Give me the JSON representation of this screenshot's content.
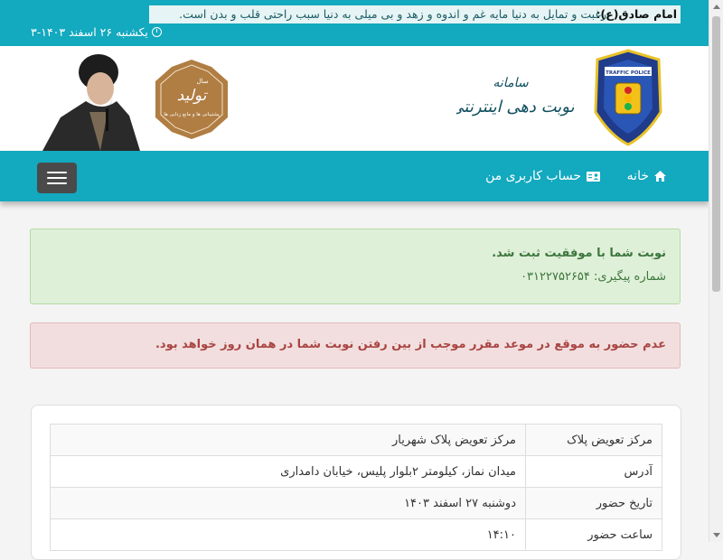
{
  "topbar": {
    "quote_label": "امام صادق(ع):",
    "quote_text": "رغبت و تمایل به دنیا مایه غم و اندوه و زهد و بی میلی به دنیا سبب راحتی قلب و بدن است.",
    "date": "یکشنبه ۲۶ اسفند ۱۴۰۳-۳",
    "clock_icon": "clock-icon"
  },
  "header": {
    "system_title_line1": "سامانه",
    "system_title_line2": "نوبت دهی اینترنتی",
    "tolid_logo_text": "تولید",
    "tolid_logo_subtext": "پشتیبانی ها و مانع زدایی ها",
    "tolid_logo_year": "سال",
    "police_logo_text": "TRAFFIC POLICE"
  },
  "nav": {
    "home_label": "خانه",
    "account_label": "حساب کاربری من",
    "home_icon": "home-icon",
    "account_icon": "id-card-icon"
  },
  "alerts": {
    "success_title": "نوبت شما با موفقیت ثبت شد.",
    "tracking_label": "شماره پیگیری:",
    "tracking_number": "۰۳۱۲۲۷۵۲۶۵۴",
    "danger_text": "عدم حضور به موقع در موعد مقرر موجب از بین رفتن نوبت شما در همان روز خواهد بود."
  },
  "table": {
    "rows": [
      {
        "label": "مرکز تعویض پلاک",
        "value": "مرکز تعویض پلاک شهریار"
      },
      {
        "label": "آدرس",
        "value": "میدان نماز، کیلومتر ۲بلوار پلیس، خیابان دامداری"
      },
      {
        "label": "تاریخ حضور",
        "value": "دوشنبه ۲۷ اسفند ۱۴۰۳"
      },
      {
        "label": "ساعت حضور",
        "value": "۱۴:۱۰"
      }
    ]
  },
  "colors": {
    "primary": "#13a9bf",
    "success_bg": "#dff0d8",
    "success_text": "#3c763d",
    "danger_bg": "#f2dede",
    "danger_text": "#a94442"
  }
}
